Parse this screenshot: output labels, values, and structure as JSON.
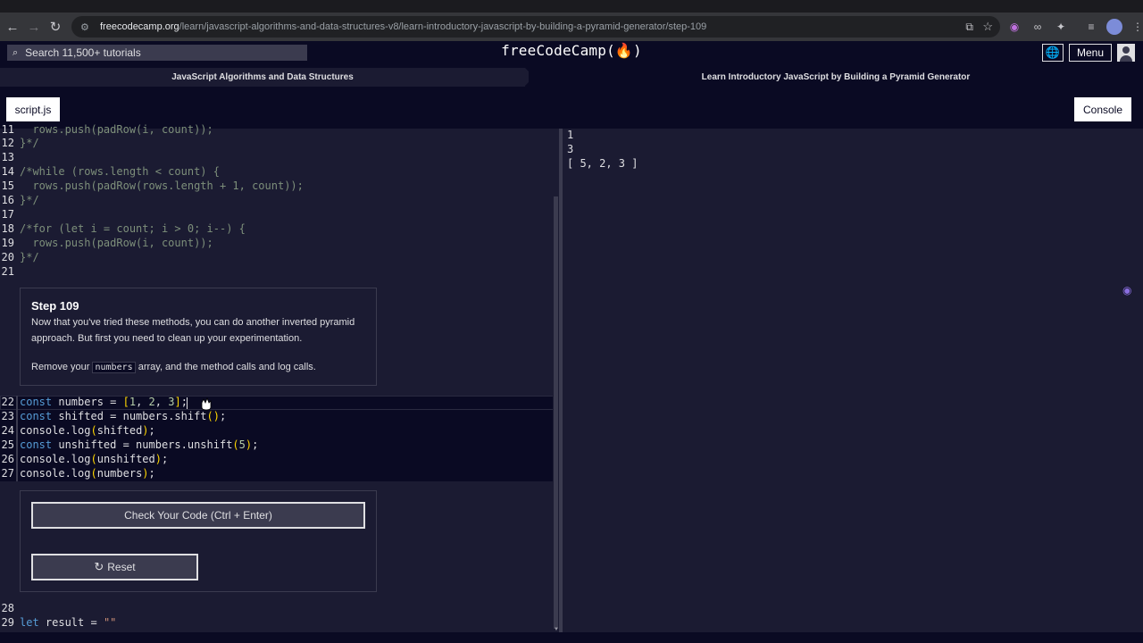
{
  "browser": {
    "url_host": "freecodecamp.org",
    "url_path": "/learn/javascript-algorithms-and-data-structures-v8/learn-introductory-javascript-by-building-a-pyramid-generator/step-109",
    "icons": [
      "back-icon",
      "forward-icon",
      "reload-icon",
      "site-info-icon",
      "install-icon",
      "star-icon",
      "extension-icon",
      "extension-icon",
      "puzzle-icon",
      "media-icon",
      "profile-icon"
    ]
  },
  "nav": {
    "search_placeholder": "Search 11,500+ tutorials",
    "logo": "freeCodeCamp(🔥)",
    "menu_label": "Menu"
  },
  "breadcrumb": {
    "superblock": "JavaScript Algorithms and Data Structures",
    "block": "Learn Introductory JavaScript by Building a Pyramid Generator"
  },
  "tabs": {
    "script": "script.js",
    "console": "Console"
  },
  "editor": {
    "top_lines": [
      {
        "n": "11",
        "t": "  rows.push(padRow(i, count));"
      },
      {
        "n": "12",
        "t": "}*/"
      },
      {
        "n": "13",
        "t": ""
      },
      {
        "n": "14",
        "t": "/*while (rows.length < count) {"
      },
      {
        "n": "15",
        "t": "  rows.push(padRow(rows.length + 1, count));"
      },
      {
        "n": "16",
        "t": "}*/"
      },
      {
        "n": "17",
        "t": ""
      },
      {
        "n": "18",
        "t": "/*for (let i = count; i > 0; i--) {"
      },
      {
        "n": "19",
        "t": "  rows.push(padRow(i, count));"
      },
      {
        "n": "20",
        "t": "}*/"
      },
      {
        "n": "21",
        "t": ""
      }
    ],
    "active_lines": [
      {
        "n": "22",
        "t": "const numbers = [1, 2, 3];"
      },
      {
        "n": "23",
        "t": "const shifted = numbers.shift();"
      },
      {
        "n": "24",
        "t": "console.log(shifted);"
      },
      {
        "n": "25",
        "t": "const unshifted = numbers.unshift(5);"
      },
      {
        "n": "26",
        "t": "console.log(unshifted);"
      },
      {
        "n": "27",
        "t": "console.log(numbers);"
      }
    ],
    "bottom_lines": [
      {
        "n": "28",
        "t": ""
      },
      {
        "n": "29",
        "t": "let result = \"\""
      }
    ]
  },
  "step": {
    "title": "Step 109",
    "paragraph1": "Now that you've tried these methods, you can do another inverted pyramid approach. But first you need to clean up your experimentation.",
    "p2_before": "Remove your ",
    "p2_code": "numbers",
    "p2_after": " array, and the method calls and log calls."
  },
  "buttons": {
    "check": "Check Your Code (Ctrl + Enter)",
    "reset": "Reset"
  },
  "console_output": [
    "1",
    "3",
    "[ 5, 2, 3 ]"
  ]
}
